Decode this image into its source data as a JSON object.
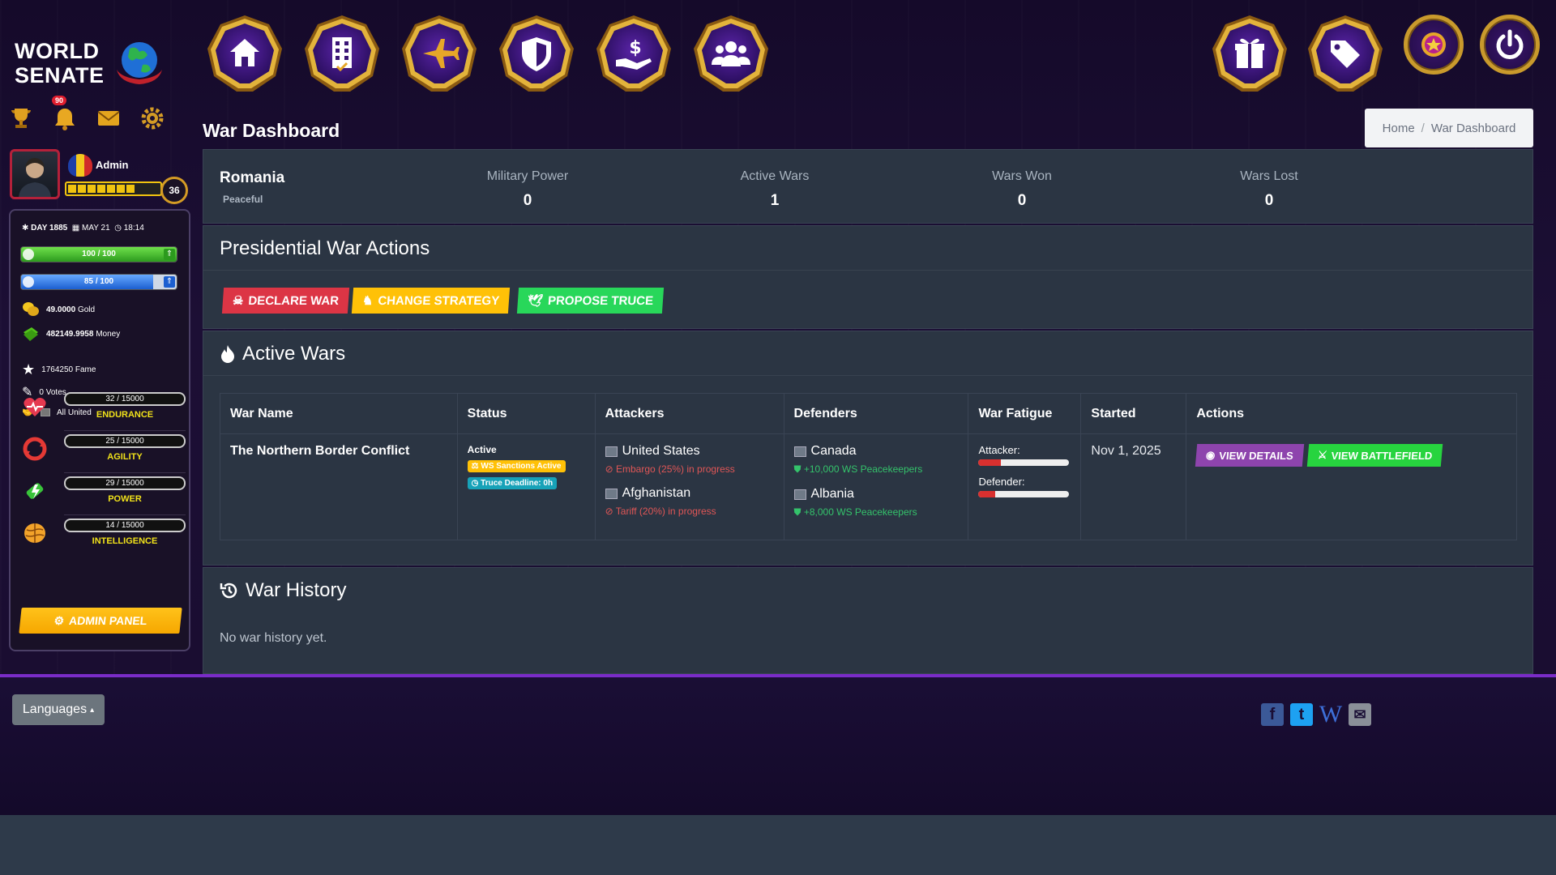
{
  "logo": {
    "line1": "WORLD",
    "line2": "SENATE"
  },
  "notifications": {
    "count": "90"
  },
  "nav": {
    "items": [
      "home-icon",
      "city-icon",
      "military-jet-icon",
      "shield-icon",
      "economy-hand-icon",
      "people-icon"
    ],
    "right_items": [
      "gift-icon",
      "tags-icon",
      "premium-star-icon",
      "power-icon"
    ]
  },
  "profile": {
    "name": "Admin",
    "level": "36",
    "xp_fraction": 0.75
  },
  "status": {
    "day": "DAY 1885",
    "date": "MAY 21",
    "time": "18:14",
    "health": "100 / 100",
    "health_fraction": 1.0,
    "energy": "85 / 100",
    "energy_fraction": 0.85
  },
  "resources": {
    "gold_value": "49.0000",
    "gold_label": "Gold",
    "money_value": "482149.9958",
    "money_label": "Money",
    "fame": "1764250 Fame",
    "votes": "0 Votes",
    "party": "All United"
  },
  "stats": [
    {
      "name": "ENDURANCE",
      "value": "32 / 15000"
    },
    {
      "name": "AGILITY",
      "value": "25 / 15000"
    },
    {
      "name": "POWER",
      "value": "29 / 15000"
    },
    {
      "name": "INTELLIGENCE",
      "value": "14 / 15000"
    }
  ],
  "admin_button": "ADMIN PANEL",
  "page": {
    "title": "War Dashboard"
  },
  "breadcrumb": {
    "home": "Home",
    "current": "War Dashboard"
  },
  "summary": {
    "country": "Romania",
    "state": "Peaceful",
    "metrics": [
      {
        "label": "Military Power",
        "value": "0"
      },
      {
        "label": "Active Wars",
        "value": "1"
      },
      {
        "label": "Wars Won",
        "value": "0"
      },
      {
        "label": "Wars Lost",
        "value": "0"
      }
    ]
  },
  "actions": {
    "title": "Presidential War Actions",
    "declare": "DECLARE WAR",
    "strategy": "CHANGE STRATEGY",
    "truce": "PROPOSE TRUCE"
  },
  "active_wars": {
    "title": "Active Wars",
    "columns": [
      "War Name",
      "Status",
      "Attackers",
      "Defenders",
      "War Fatigue",
      "Started",
      "Actions"
    ],
    "rows": [
      {
        "name": "The Northern Border Conflict",
        "status": "Active",
        "badge1": "WS Sanctions Active",
        "badge2": "Truce Deadline: 0h",
        "attackers": [
          {
            "country": "United States",
            "note": "Embargo (25%) in progress"
          },
          {
            "country": "Afghanistan",
            "note": "Tariff (20%) in progress"
          }
        ],
        "defenders": [
          {
            "country": "Canada",
            "note": "+10,000 WS Peacekeepers"
          },
          {
            "country": "Albania",
            "note": "+8,000 WS Peacekeepers"
          }
        ],
        "fatigue_attacker_label": "Attacker:",
        "fatigue_attacker": 0.25,
        "fatigue_defender_label": "Defender:",
        "fatigue_defender": 0.18,
        "started": "Nov 1, 2025",
        "view_details": "VIEW DETAILS",
        "view_battlefield": "VIEW BATTLEFIELD"
      }
    ]
  },
  "history": {
    "title": "War History",
    "empty": "No war history yet."
  },
  "footer": {
    "languages": "Languages"
  },
  "social": {
    "facebook": "f",
    "twitter": "t",
    "wiki": "W",
    "mail": "✉"
  },
  "colors": {
    "declare": "#dc3545",
    "strategy": "#ffc107",
    "truce": "#28d75a",
    "details": "#8e44ad",
    "battlefield": "#27d43f",
    "card": "#2b3543"
  }
}
